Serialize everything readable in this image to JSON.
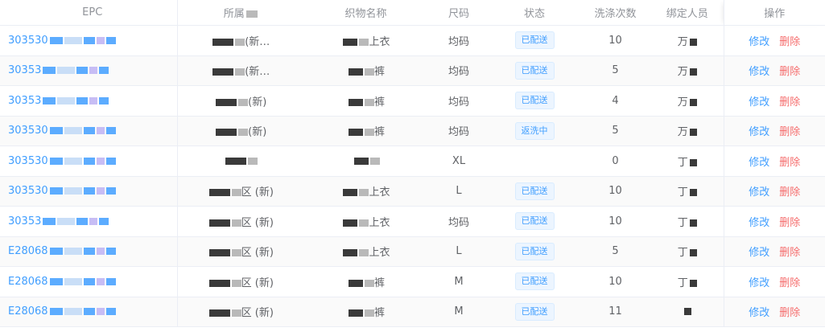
{
  "columns": {
    "epc": "EPC",
    "dept": "所属",
    "item_name": "织物名称",
    "size": "尺码",
    "status": "状态",
    "wash_count": "洗涤次数",
    "person": "绑定人员",
    "actions": "操作"
  },
  "action_labels": {
    "edit": "修改",
    "delete": "删除"
  },
  "rows": [
    {
      "epc": "303530",
      "dept": "(新…",
      "item_name": "上衣",
      "size": "均码",
      "status": "已配送",
      "wash_count": "10",
      "person": "万"
    },
    {
      "epc": "30353",
      "dept": "(新…",
      "item_name": "裤",
      "size": "均码",
      "status": "已配送",
      "wash_count": "5",
      "person": "万"
    },
    {
      "epc": "30353",
      "dept": "(新)",
      "item_name": "裤",
      "size": "均码",
      "status": "已配送",
      "wash_count": "4",
      "person": "万"
    },
    {
      "epc": "303530",
      "dept": "(新)",
      "item_name": "裤",
      "size": "均码",
      "status": "返洗中",
      "wash_count": "5",
      "person": "万"
    },
    {
      "epc": "303530",
      "dept": "",
      "item_name": "",
      "size": "XL",
      "status": "",
      "wash_count": "0",
      "person": "丁"
    },
    {
      "epc": "303530",
      "dept": "区 (新)",
      "item_name": "上衣",
      "size": "L",
      "status": "已配送",
      "wash_count": "10",
      "person": "丁"
    },
    {
      "epc": "30353",
      "dept": "区 (新)",
      "item_name": "上衣",
      "size": "均码",
      "status": "已配送",
      "wash_count": "10",
      "person": "丁"
    },
    {
      "epc": "E28068",
      "dept": "区 (新)",
      "item_name": "上衣",
      "size": "L",
      "status": "已配送",
      "wash_count": "5",
      "person": "丁"
    },
    {
      "epc": "E28068",
      "dept": "区 (新)",
      "item_name": "裤",
      "size": "M",
      "status": "已配送",
      "wash_count": "10",
      "person": "丁"
    },
    {
      "epc": "E28068",
      "dept": "区 (新)",
      "item_name": "裤",
      "size": "M",
      "status": "已配送",
      "wash_count": "11",
      "person": ""
    }
  ]
}
